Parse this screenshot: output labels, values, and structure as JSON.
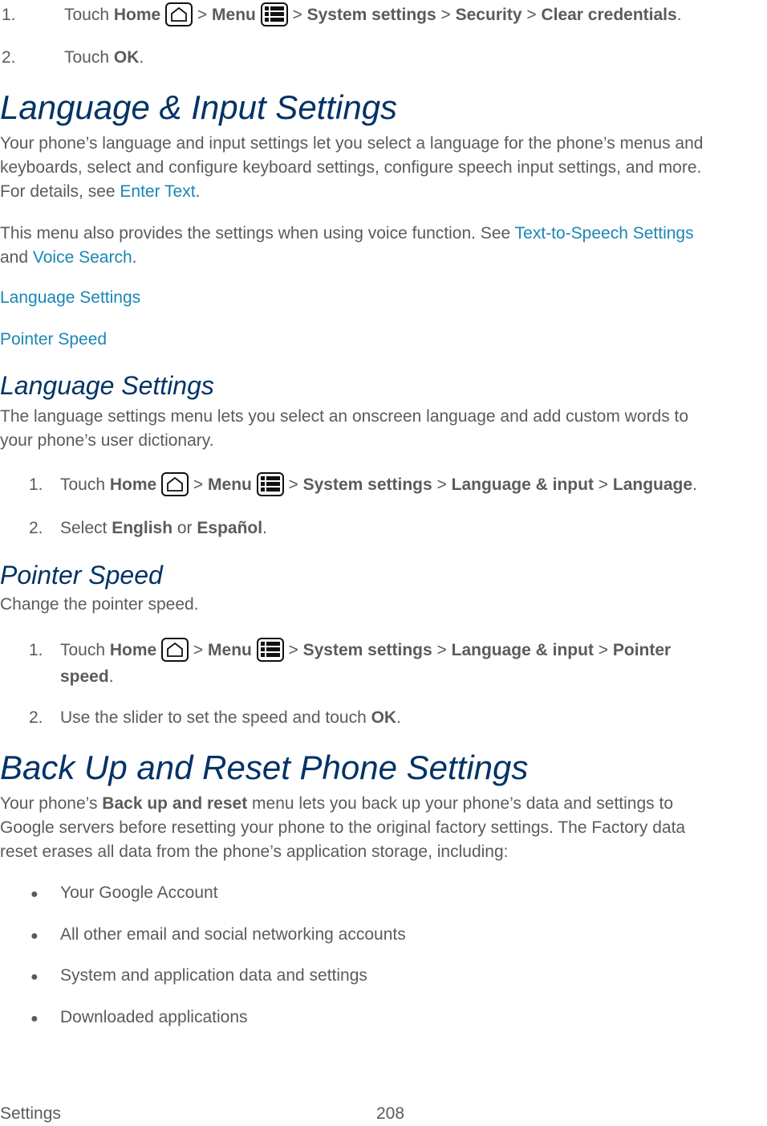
{
  "top_steps": [
    {
      "num": "1.",
      "t1": "Touch ",
      "home": "Home",
      "sep1": " > ",
      "menu": "Menu",
      "sep2": " > ",
      "p1": "System settings",
      "sep3": " > ",
      "p2": "Security",
      "sep4": " > ",
      "p3": "Clear credentials",
      "end": "."
    },
    {
      "num": "2.",
      "t1": "Touch ",
      "b": "OK",
      "end": "."
    }
  ],
  "lang_input": {
    "title": "Language & Input Settings",
    "para1_line1": "Your phone’s language and input settings let you select a language for the phone’s menus and",
    "para1_line2": "keyboards, select and configure keyboard settings, configure speech input settings, and more.",
    "para1_line3_pre": "For details, see ",
    "para1_link": "Enter Text",
    "para1_line3_post": ".",
    "para2_pre": "This menu also provides the settings when using voice function. See ",
    "para2_link1": "Text-to-Speech Settings",
    "para2_mid": "and ",
    "para2_link2": "Voice Search",
    "para2_post": ".",
    "links": [
      "Language Settings",
      "Pointer Speed"
    ]
  },
  "language_settings": {
    "title": "Language Settings",
    "para_line1": "The language settings menu lets you select an onscreen language and add custom words to",
    "para_line2": "your phone’s user dictionary.",
    "step1": {
      "num": "1.",
      "t1": "Touch ",
      "home": "Home",
      "sep1": " > ",
      "menu": "Menu",
      "sep2": " > ",
      "p1": "System settings",
      "sep3": " > ",
      "p2": "Language & input",
      "sep4": " > ",
      "p3": "Language",
      "end": "."
    },
    "step2": {
      "num": "2.",
      "t1": "Select ",
      "b1": "English",
      "mid": " or ",
      "b2": "Español",
      "end": "."
    }
  },
  "pointer_speed": {
    "title": "Pointer Speed",
    "para": "Change the pointer speed.",
    "step1": {
      "num": "1.",
      "t1": "Touch ",
      "home": "Home",
      "sep1": " > ",
      "menu": "Menu",
      "sep2": " > ",
      "p1": "System settings",
      "sep3": " > ",
      "p2": "Language & input",
      "sep4": " > ",
      "p3a": "Pointer",
      "p3b": "speed",
      "end": "."
    },
    "step2": {
      "num": "2.",
      "t1": "Use the slider to set the speed and touch ",
      "b": "OK",
      "end": "."
    }
  },
  "backup": {
    "title": "Back Up and Reset Phone Settings",
    "line1_pre": "Your phone’s ",
    "line1_b": "Back up and reset",
    "line1_post": " menu lets you back up your phone’s data and settings to",
    "line2": "Google servers before resetting your phone to the original factory settings. The Factory data",
    "line3": "reset erases all data from the phone’s application storage, including:",
    "bullets": [
      "Your Google Account",
      "All other email and social networking accounts",
      "System and application data and settings",
      "Downloaded applications"
    ],
    "bullet_char": "●"
  },
  "footer": {
    "section": "Settings",
    "page": "208"
  },
  "colors": {
    "heading": "#003366",
    "link": "#1a86b4",
    "text": "#5b5b5b"
  }
}
